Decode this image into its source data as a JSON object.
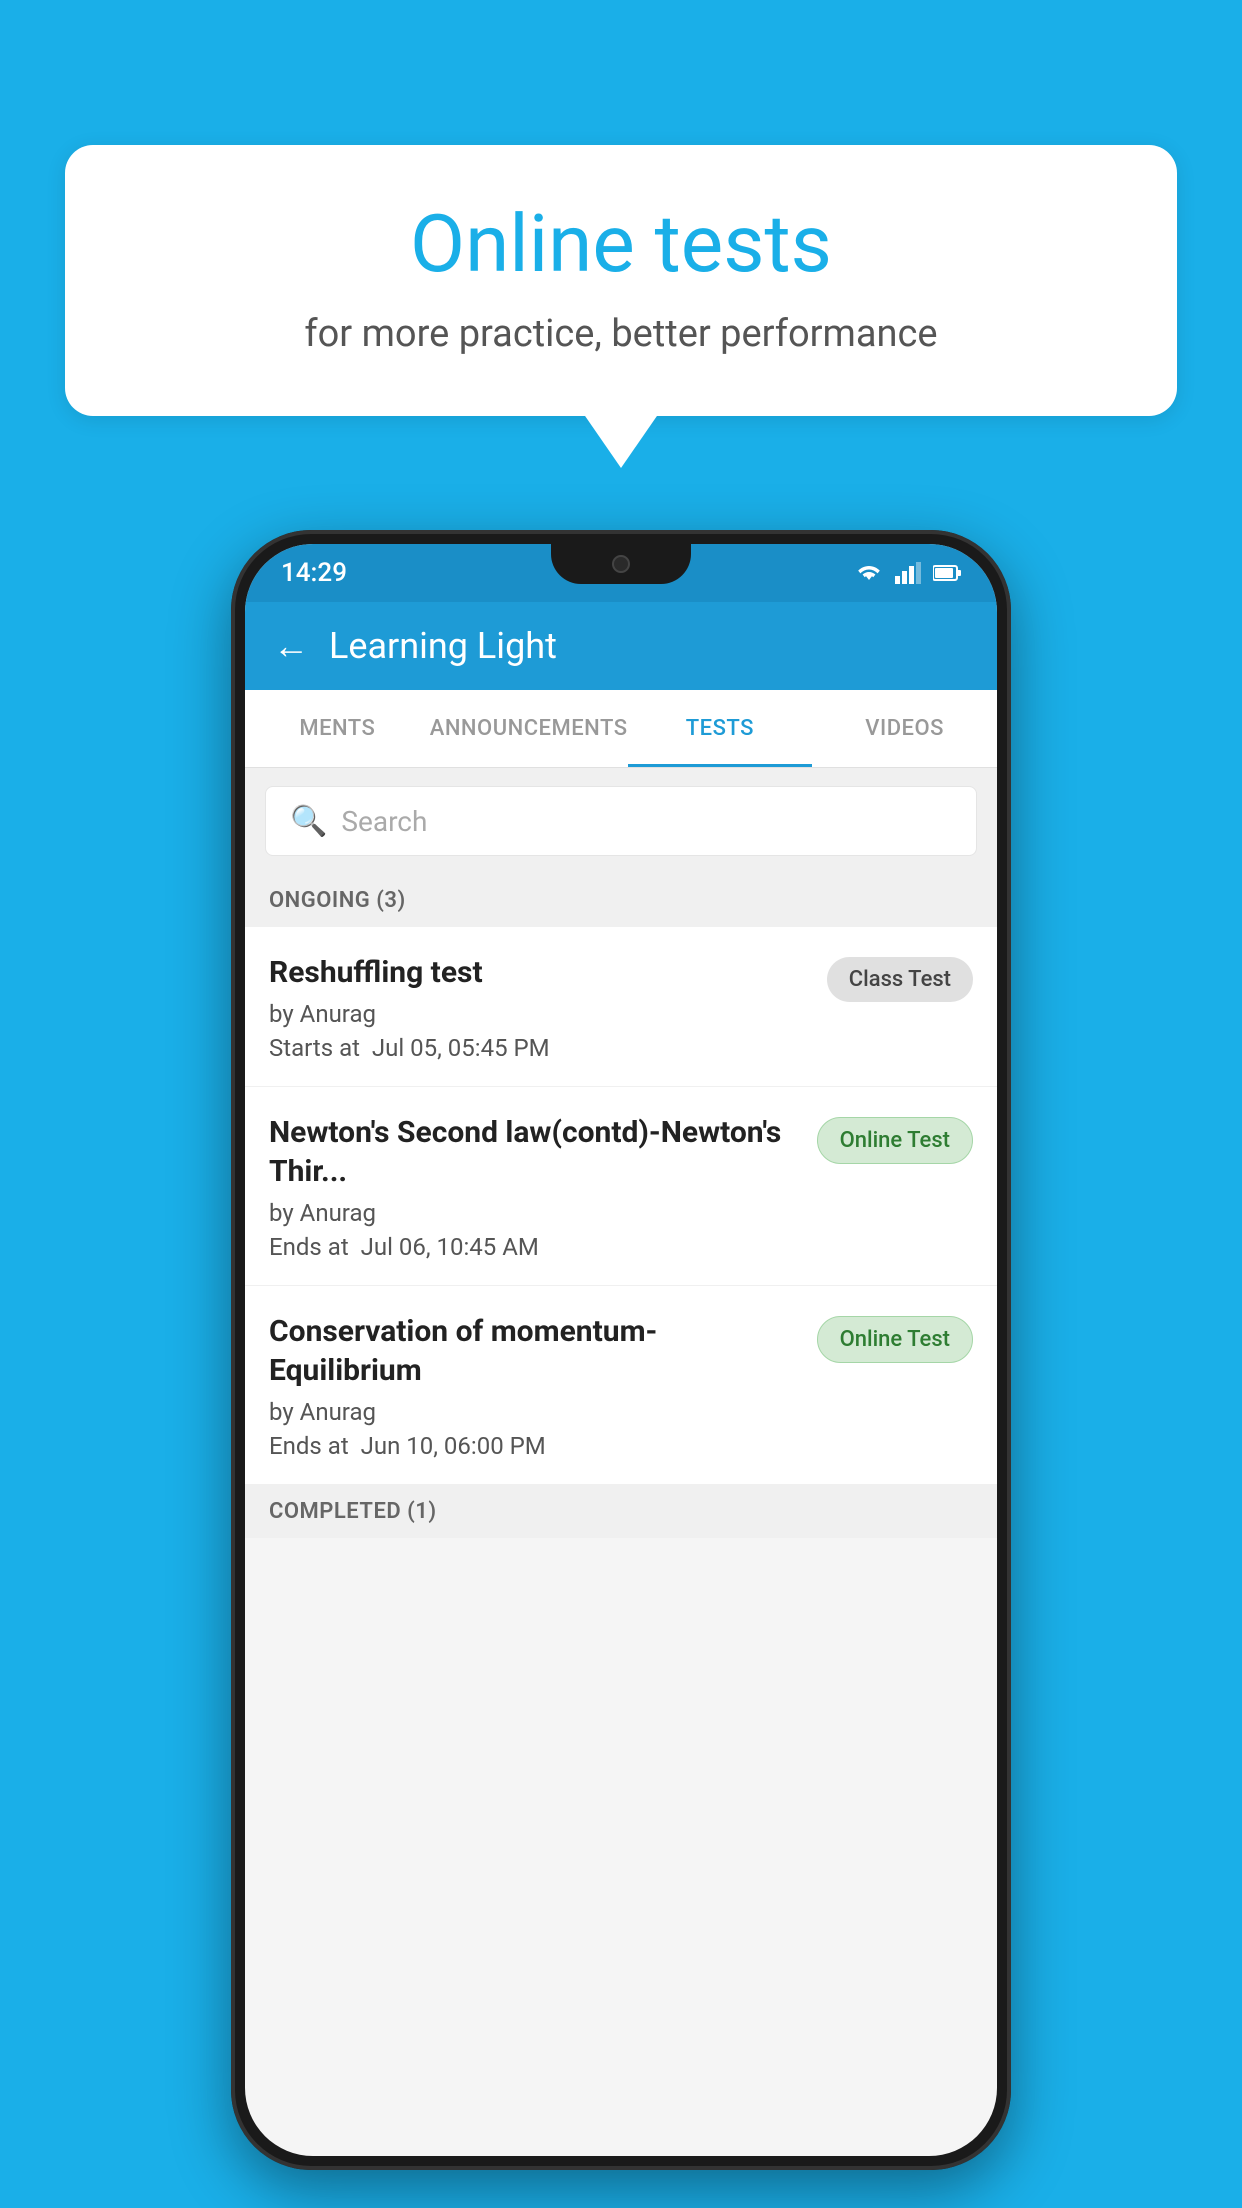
{
  "background": {
    "color": "#1AAFE8"
  },
  "bubble": {
    "title": "Online tests",
    "subtitle": "for more practice, better performance"
  },
  "phone": {
    "status_bar": {
      "time": "14:29"
    },
    "header": {
      "title": "Learning Light",
      "back_label": "←"
    },
    "tabs": [
      {
        "label": "MENTS",
        "active": false
      },
      {
        "label": "ANNOUNCEMENTS",
        "active": false
      },
      {
        "label": "TESTS",
        "active": true
      },
      {
        "label": "VIDEOS",
        "active": false
      }
    ],
    "search": {
      "placeholder": "Search"
    },
    "ongoing_section": {
      "label": "ONGOING (3)"
    },
    "tests": [
      {
        "name": "Reshuffling test",
        "by": "by Anurag",
        "date_label": "Starts at",
        "date": "Jul 05, 05:45 PM",
        "badge": "Class Test",
        "badge_type": "class"
      },
      {
        "name": "Newton's Second law(contd)-Newton's Thir...",
        "by": "by Anurag",
        "date_label": "Ends at",
        "date": "Jul 06, 10:45 AM",
        "badge": "Online Test",
        "badge_type": "online"
      },
      {
        "name": "Conservation of momentum-Equilibrium",
        "by": "by Anurag",
        "date_label": "Ends at",
        "date": "Jun 10, 06:00 PM",
        "badge": "Online Test",
        "badge_type": "online"
      }
    ],
    "completed_section": {
      "label": "COMPLETED (1)"
    }
  }
}
